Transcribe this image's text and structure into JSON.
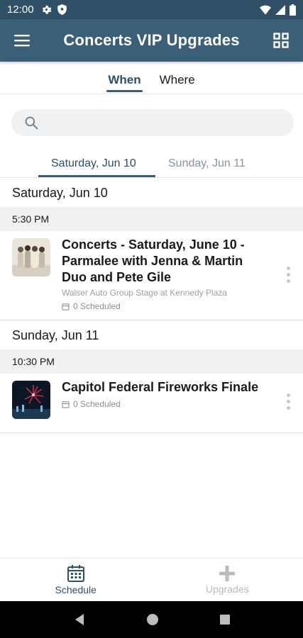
{
  "status_bar": {
    "time": "12:00"
  },
  "app_bar": {
    "title": "Concerts VIP Upgrades"
  },
  "top_tabs": [
    {
      "label": "When",
      "active": true
    },
    {
      "label": "Where",
      "active": false
    }
  ],
  "search": {
    "placeholder": "",
    "value": ""
  },
  "date_tabs": [
    {
      "label": "Saturday, Jun 10",
      "active": true
    },
    {
      "label": "Sunday, Jun 11",
      "active": false
    }
  ],
  "schedule": [
    {
      "day": "Saturday, Jun 10",
      "time": "5:30 PM",
      "event": {
        "name": "Concerts - Saturday, June 10 - Parmalee with Jenna & Martin Duo and Pete Gile",
        "venue": "Walser Auto Group Stage at Kennedy Plaza",
        "scheduled": "0 Scheduled"
      }
    },
    {
      "day": "Sunday, Jun 11",
      "time": "10:30 PM",
      "event": {
        "name": "Capitol Federal Fireworks Finale",
        "venue": "",
        "scheduled": "0 Scheduled"
      }
    }
  ],
  "bottom_nav": [
    {
      "label": "Schedule",
      "icon": "calendar-icon",
      "active": true
    },
    {
      "label": "Upgrades",
      "icon": "plus-icon",
      "active": false
    }
  ],
  "colors": {
    "primary": "#3b5f77",
    "status_bar": "#2f4f66",
    "accent_text": "#2f4f66"
  }
}
